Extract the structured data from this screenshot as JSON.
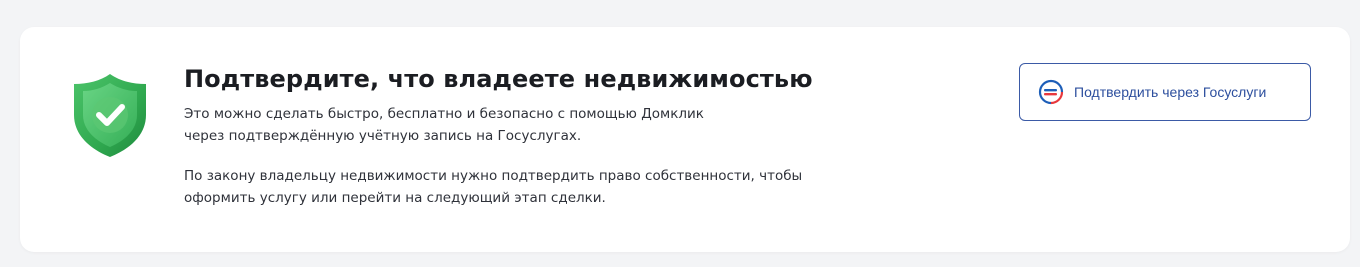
{
  "card": {
    "title": "Подтвердите, что владеете недвижимостью",
    "paragraph1": "Это можно сделать быстро, бесплатно и безопасно с помощью Домклик через подтверждённую учётную запись на Госуслугах.",
    "paragraph2": "По закону владельцу недвижимости нужно подтвердить право собственности, чтобы оформить услугу или перейти на следующий этап сделки.",
    "shield_icon": "shield-check-icon",
    "colors": {
      "shield_green": "#2fa84f",
      "button_border": "#3b5aa6",
      "button_text": "#2d4f9e",
      "gos_red": "#e8383d",
      "gos_blue": "#1d5eb8"
    }
  },
  "action": {
    "button_label": "Подтвердить через Госуслуги",
    "button_icon": "gosuslugi-logo-icon"
  }
}
